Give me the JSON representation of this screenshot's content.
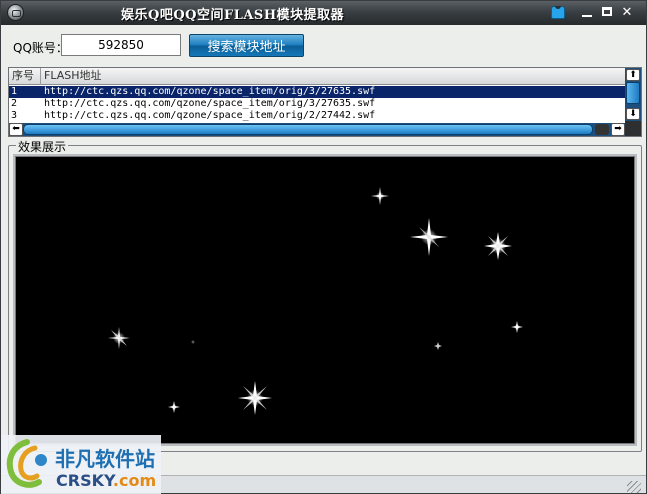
{
  "window": {
    "title": "娱乐Q吧QQ空间FLASH模块提取器",
    "controls": {
      "minimize_icon": "minimize-icon",
      "maximize_icon": "maximize-icon",
      "close_icon": "close-icon",
      "close_glyph": "✕",
      "skin_icon": "shirt-icon"
    }
  },
  "search": {
    "label": "QQ账号：",
    "value": "592850",
    "button_label": "搜索模块地址"
  },
  "list": {
    "columns": [
      "序号",
      "FLASH地址"
    ],
    "rows": [
      {
        "index": "1",
        "url": "http://ctc.qzs.qq.com/qzone/space_item/orig/3/27635.swf",
        "selected": true
      },
      {
        "index": "2",
        "url": "http://ctc.qzs.qq.com/qzone/space_item/orig/3/27635.swf",
        "selected": false
      },
      {
        "index": "3",
        "url": "http://ctc.qzs.qq.com/qzone/space_item/orig/2/27442.swf",
        "selected": false
      }
    ],
    "scroll_up": "⬆",
    "scroll_down": "⬇",
    "scroll_left": "⬅",
    "scroll_right": "➡"
  },
  "preview": {
    "legend": "效果展示"
  },
  "watermark": {
    "cn": "非凡软件站",
    "en_main": "CRSKY",
    "en_dot": ".com"
  },
  "colors": {
    "titlebar": "#3a3f43",
    "accent_button": "#1c7dbd",
    "selection": "#0a246a",
    "screen": "#000000"
  }
}
